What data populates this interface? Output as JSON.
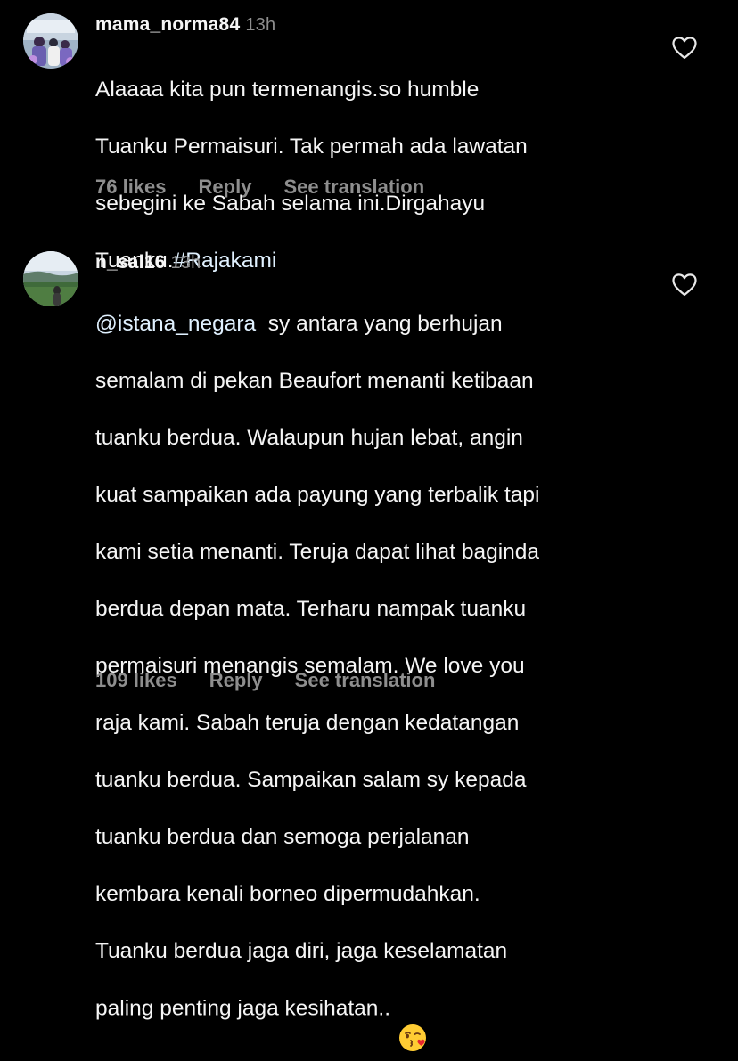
{
  "comments": [
    {
      "username": "mama_norma84",
      "time": "13h",
      "text_lines": [
        "Alaaaa kita pun termenangis.so humble",
        "Tuanku Permaisuri. Tak permah ada  lawatan",
        "sebegini ke Sabah  selama ini.Dirgahayu",
        "Tuanku."
      ],
      "hashtag": "#Rajakami",
      "likes": "76 likes",
      "reply": "Reply",
      "translate": "See translation"
    },
    {
      "username": "n_sal16",
      "time": "13h",
      "mention": "@istana_negara",
      "text_lines": [
        "  sy antara yang berhujan",
        "semalam di pekan Beaufort menanti ketibaan",
        "tuanku berdua. Walaupun hujan lebat, angin",
        "kuat sampaikan ada payung yang terbalik tapi",
        "kami setia menanti. Teruja dapat lihat baginda",
        "berdua depan mata. Terharu nampak tuanku",
        "permaisuri menangis semalam. We love you",
        "raja kami. Sabah teruja dengan kedatangan",
        "tuanku berdua. Sampaikan salam sy kepada",
        "tuanku berdua dan semoga perjalanan",
        "kembara kenali borneo dipermudahkan.",
        "Tuanku berdua jaga diri, jaga keselamatan",
        "paling penting jaga kesihatan.."
      ],
      "emoji": "face-blowing-a-kiss",
      "likes": "109 likes",
      "reply": "Reply",
      "translate": "See translation"
    }
  ],
  "colors": {
    "background": "#000000",
    "primary_text": "#f5f5f5",
    "secondary_text": "#8e8e8e",
    "link_text": "#e0f1ff"
  }
}
